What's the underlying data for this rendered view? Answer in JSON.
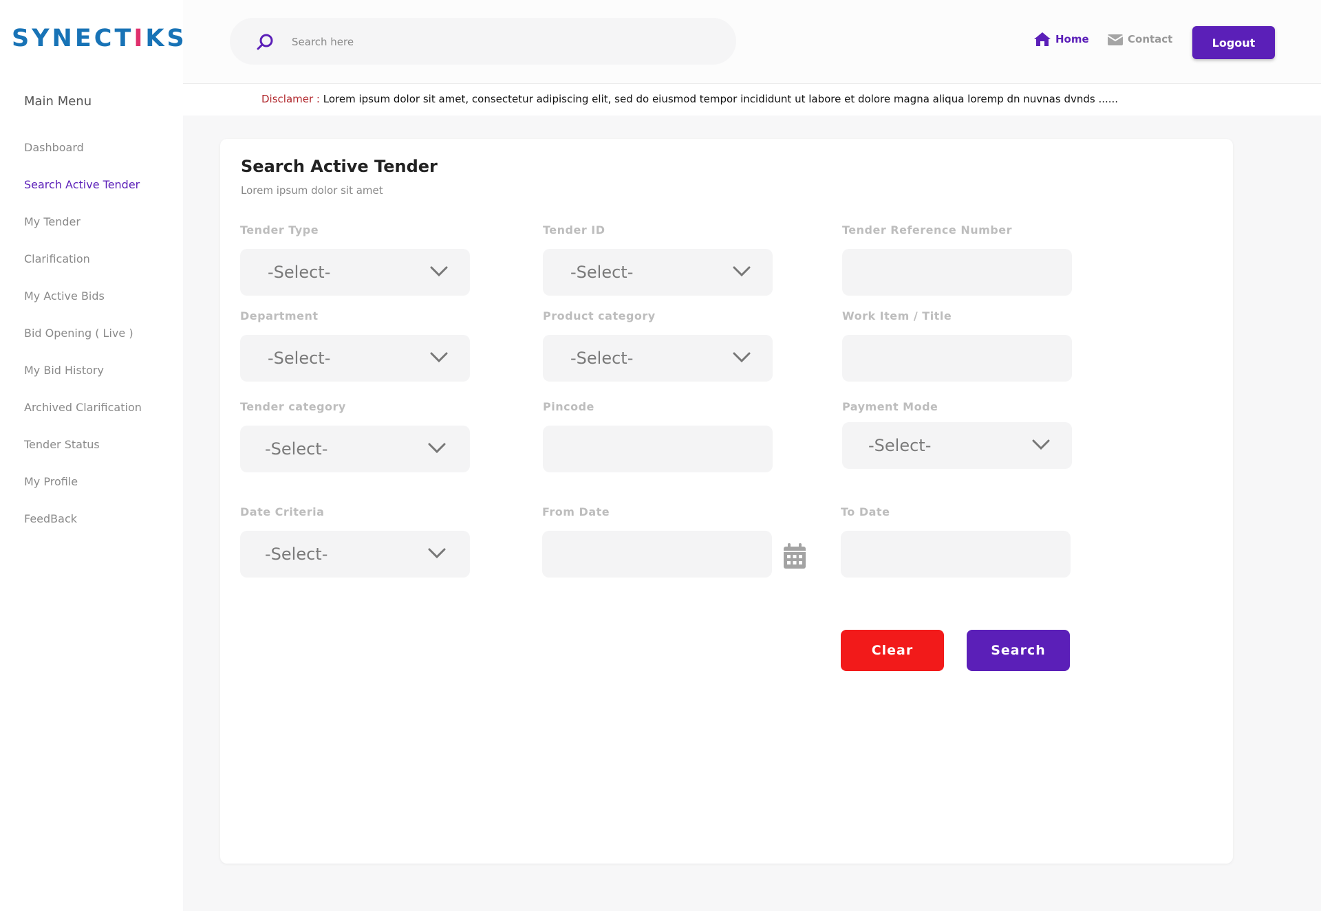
{
  "brand": {
    "logo_pre": "SYNECT",
    "logo_i": "I",
    "logo_post": "KS"
  },
  "sidebar": {
    "title": "Main Menu",
    "items": [
      {
        "label": "Dashboard"
      },
      {
        "label": "Search Active Tender",
        "active": true
      },
      {
        "label": "My Tender"
      },
      {
        "label": "Clarification"
      },
      {
        "label": "My Active Bids"
      },
      {
        "label": "Bid Opening ( Live )"
      },
      {
        "label": "My Bid History"
      },
      {
        "label": "Archived Clarification"
      },
      {
        "label": "Tender Status"
      },
      {
        "label": "My Profile"
      },
      {
        "label": "FeedBack"
      }
    ]
  },
  "header": {
    "search_placeholder": "Search here",
    "home_label": "Home",
    "contact_label": "Contact",
    "logout_label": "Logout"
  },
  "disclaimer": {
    "label": "Disclamer :",
    "text": "Lorem ipsum dolor sit amet, consectetur adipiscing elit, sed do eiusmod tempor incididunt ut labore et dolore magna aliqua loremp dn  nuvnas dvnds ......"
  },
  "form": {
    "title": "Search Active Tender",
    "subtitle": "Lorem ipsum dolor sit amet",
    "select_placeholder": "-Select-",
    "fields": {
      "tender_type": "Tender Type",
      "tender_id": "Tender ID",
      "tender_ref": "Tender Reference Number",
      "department": "Department",
      "product_category": "Product category",
      "work_item": "Work Item / Title",
      "tender_category": "Tender category",
      "pincode": "Pincode",
      "payment_mode": "Payment Mode",
      "date_criteria": "Date Criteria",
      "from_date": "From Date",
      "to_date": "To Date"
    },
    "clear_label": "Clear",
    "search_label": "Search"
  },
  "colors": {
    "accent": "#5b1fb8",
    "danger": "#f21a1a",
    "logo_blue": "#1873b6",
    "logo_pink": "#e0306d"
  }
}
